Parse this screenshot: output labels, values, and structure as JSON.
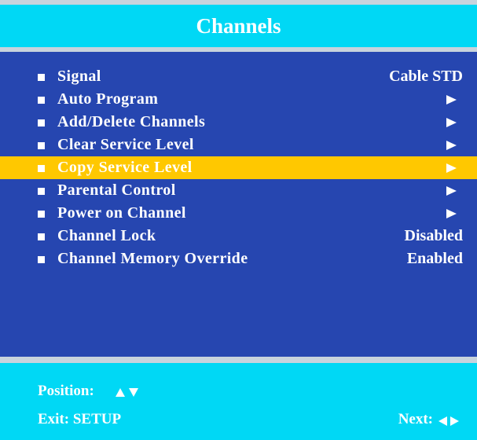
{
  "colors": {
    "header_bg": "#00d8f5",
    "body_bg": "#2646b0",
    "selected_bg": "#ffc800",
    "text": "#ffffff",
    "frame": "#c8d3dd"
  },
  "header": {
    "title": "Channels"
  },
  "menu": {
    "items": [
      {
        "label": "Signal",
        "value": "Cable STD",
        "arrow": false,
        "selected": false
      },
      {
        "label": "Auto Program",
        "value": "",
        "arrow": true,
        "selected": false
      },
      {
        "label": "Add/Delete Channels",
        "value": "",
        "arrow": true,
        "selected": false
      },
      {
        "label": "Clear Service Level",
        "value": "",
        "arrow": true,
        "selected": false
      },
      {
        "label": "Copy Service Level",
        "value": "",
        "arrow": true,
        "selected": true
      },
      {
        "label": "Parental Control",
        "value": "",
        "arrow": true,
        "selected": false
      },
      {
        "label": "Power on Channel",
        "value": "",
        "arrow": true,
        "selected": false
      },
      {
        "label": "Channel Lock",
        "value": "Disabled",
        "arrow": false,
        "selected": false
      },
      {
        "label": "Channel Memory Override",
        "value": "Enabled",
        "arrow": false,
        "selected": false
      }
    ],
    "bullet_icon": "square-bullet-icon",
    "arrow_icon": "right-arrow-icon"
  },
  "footer": {
    "position_label": "Position:",
    "position_icons": [
      "up-triangle-icon",
      "down-triangle-icon"
    ],
    "exit_label": "Exit: SETUP",
    "next_label": "Next:",
    "next_icons": [
      "left-triangle-icon",
      "right-triangle-icon"
    ]
  }
}
